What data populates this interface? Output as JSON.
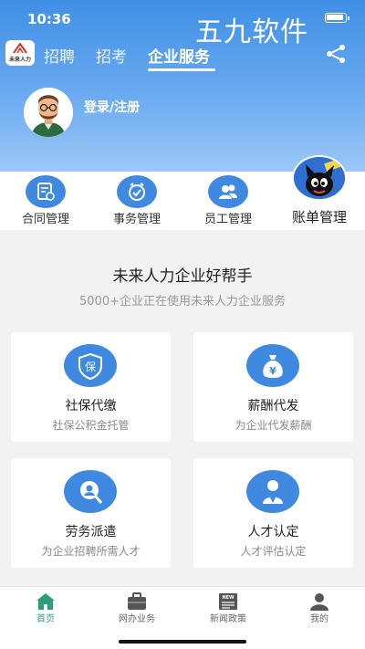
{
  "status_bar": {
    "time": "10:36"
  },
  "watermark": "五九软件",
  "logo": {
    "text": "未来人力"
  },
  "top_nav": {
    "tabs": [
      "招聘",
      "招考",
      "企业服务"
    ],
    "active_index": 2
  },
  "user": {
    "login_label": "登录/注册"
  },
  "quick_actions": [
    {
      "label": "合同管理",
      "icon": "contract-icon"
    },
    {
      "label": "事务管理",
      "icon": "clock-icon"
    },
    {
      "label": "员工管理",
      "icon": "users-icon"
    },
    {
      "label": "账单管理",
      "icon": "cat-mascot-icon"
    }
  ],
  "main": {
    "title": "未来人力企业好帮手",
    "subtitle": "5000+企业正在使用未来人力企业服务",
    "services": [
      {
        "title": "社保代缴",
        "desc": "社保公积金托管",
        "icon": "insurance-shield-icon",
        "glyph": "保"
      },
      {
        "title": "薪酬代发",
        "desc": "为企业代发薪酬",
        "icon": "money-bag-icon",
        "glyph": "¥"
      },
      {
        "title": "劳务派遣",
        "desc": "为企业招聘所需人才",
        "icon": "search-person-icon"
      },
      {
        "title": "人才认定",
        "desc": "人才评估认定",
        "icon": "person-badge-icon"
      }
    ]
  },
  "tabbar": {
    "items": [
      {
        "label": "首页",
        "icon": "home-icon"
      },
      {
        "label": "网办业务",
        "icon": "briefcase-icon"
      },
      {
        "label": "新闻政策",
        "icon": "news-icon",
        "badge": "NEW"
      },
      {
        "label": "我的",
        "icon": "profile-icon"
      }
    ],
    "active_index": 0
  },
  "colors": {
    "primary": "#3f8ae0",
    "active_tab": "#2e9e78",
    "header_top": "#3f8fe6"
  }
}
